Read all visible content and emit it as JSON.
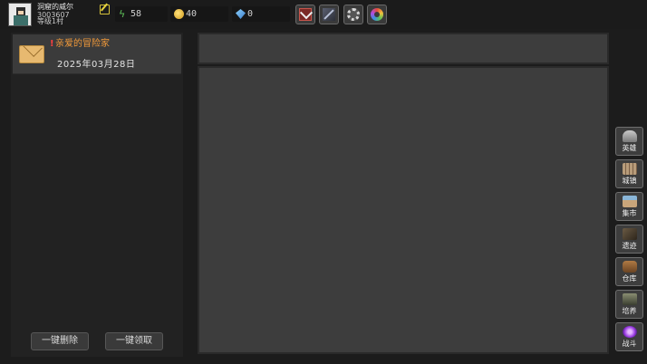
{
  "player": {
    "name": "洞窟的威尔",
    "id": "3003607",
    "level": "等级1村"
  },
  "resources": {
    "energy": {
      "icon": "energy-bolt-icon",
      "value": "58"
    },
    "coins": {
      "icon": "coin-icon",
      "value": "40"
    },
    "gems": {
      "icon": "gem-icon",
      "value": "0"
    }
  },
  "toolbar": {
    "buttons": [
      "mail-button",
      "weapon-button",
      "settings-gear-button",
      "color-wheel-button"
    ]
  },
  "mail": {
    "items": [
      {
        "unread_mark": "!",
        "title": "亲爱的冒险家",
        "date": "2025年03月28日"
      }
    ],
    "delete_all_label": "一键删除",
    "claim_all_label": "一键领取"
  },
  "sidebar": {
    "items": [
      {
        "label": "英雄",
        "icon": "hero-helmet-icon"
      },
      {
        "label": "城镇",
        "icon": "town-wall-icon"
      },
      {
        "label": "集市",
        "icon": "market-stall-icon"
      },
      {
        "label": "遗迹",
        "icon": "relic-ruins-icon"
      },
      {
        "label": "仓库",
        "icon": "warehouse-chest-icon"
      },
      {
        "label": "培养",
        "icon": "training-dummy-icon"
      },
      {
        "label": "战斗",
        "icon": "battle-portal-icon"
      }
    ]
  },
  "colors": {
    "mail_title": "#f29a3a",
    "unread_mark": "#ff4040",
    "panel_bg": "#3d3d3d",
    "page_bg": "#1c1c1c"
  }
}
